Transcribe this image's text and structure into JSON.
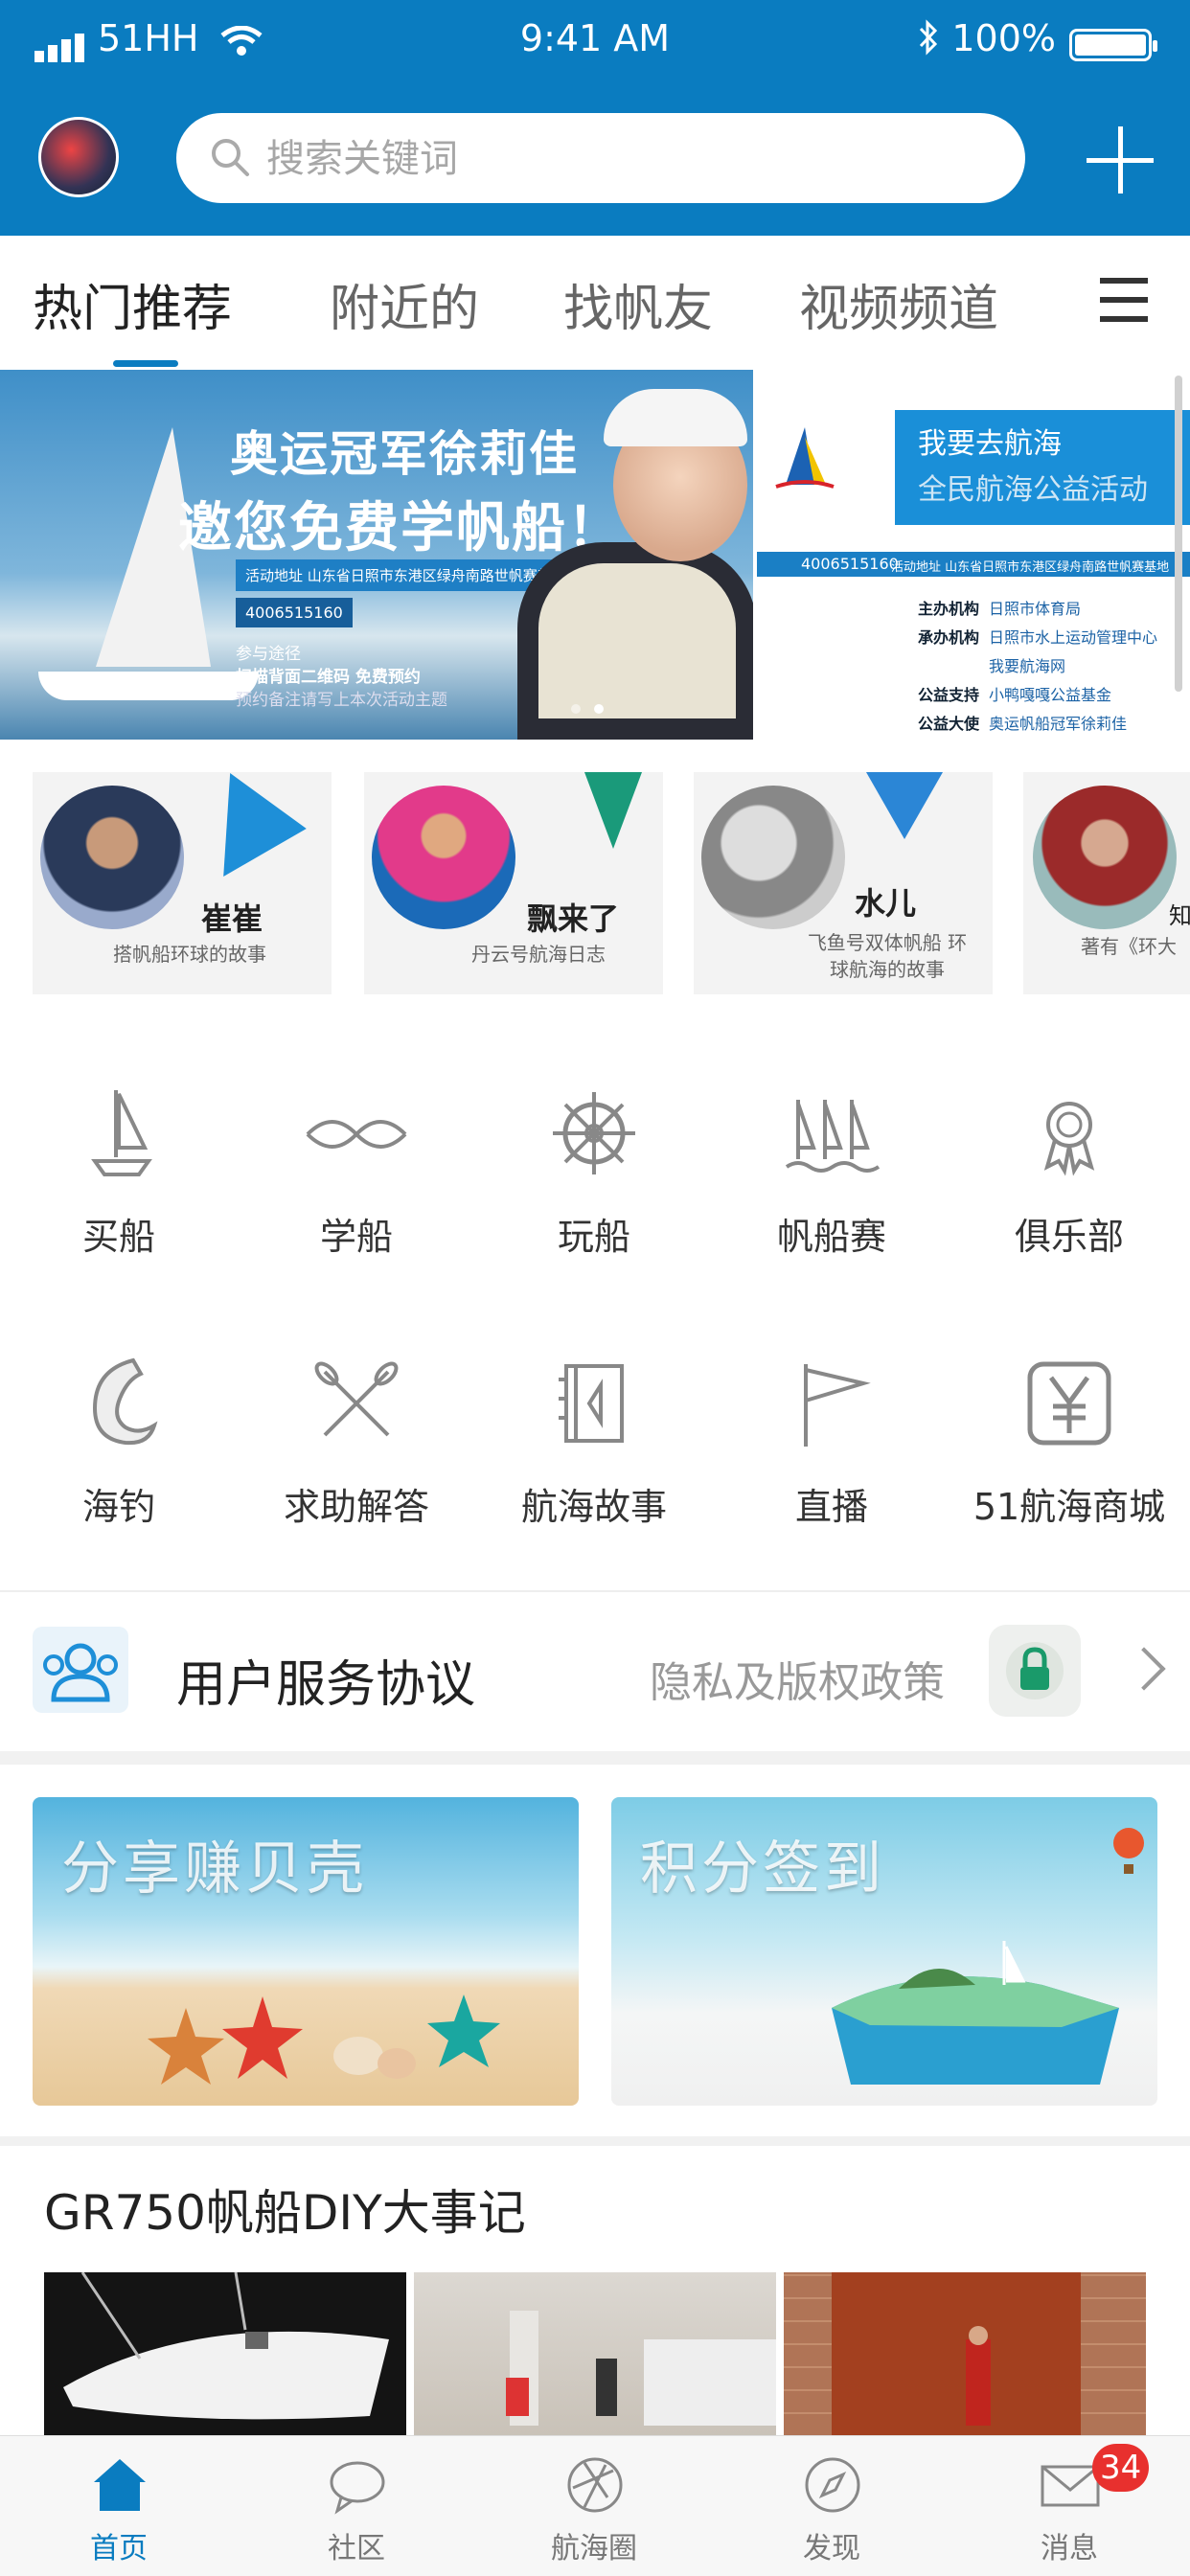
{
  "status_bar": {
    "carrier": "51HH",
    "time": "9:41 AM",
    "battery": "100%"
  },
  "search": {
    "placeholder": "搜索关键词"
  },
  "tabs": [
    {
      "label": "热门推荐",
      "active": true
    },
    {
      "label": "附近的",
      "active": false
    },
    {
      "label": "找帆友",
      "active": false
    },
    {
      "label": "视频频道",
      "active": false
    }
  ],
  "banner": {
    "title_line1": "奥运冠军徐莉佳",
    "title_line2": "邀您免费学帆船！",
    "address": "活动地址 山东省日照市东港区绿舟南路世帆赛基地",
    "phone": "4006515160",
    "step_label": "参与途径",
    "step_detail": "扫描背面二维码 免费预约",
    "note": "预约备注请写上本次活动主题",
    "right_title1": "我要去航海",
    "right_title2": "全民航海公益活动",
    "right_phone": "4006515160",
    "right_address": "活动地址 山东省日照市东港区绿舟南路世帆赛基地",
    "right_lines": [
      {
        "k": "主办机构",
        "v": "日照市体育局"
      },
      {
        "k": "承办机构",
        "v": "日照市水上运动管理中心"
      },
      {
        "k": "",
        "v": "我要航海网"
      },
      {
        "k": "公益支持",
        "v": "小鸭嘎嘎公益基金"
      },
      {
        "k": "公益大使",
        "v": "奥运帆船冠军徐莉佳"
      }
    ]
  },
  "stories": [
    {
      "name": "崔崔",
      "desc": "搭帆船环球的故事"
    },
    {
      "name": "飘来了",
      "desc": "丹云号航海日志"
    },
    {
      "name": "水儿",
      "desc": "飞鱼号双体帆船 环球航海的故事"
    },
    {
      "name": "知",
      "desc": "著有《环大"
    }
  ],
  "grid": [
    {
      "label": "买船",
      "icon": "sailboat-icon"
    },
    {
      "label": "学船",
      "icon": "knot-icon"
    },
    {
      "label": "玩船",
      "icon": "helm-wheel-icon"
    },
    {
      "label": "帆船赛",
      "icon": "regatta-icon"
    },
    {
      "label": "俱乐部",
      "icon": "badge-icon"
    },
    {
      "label": "海钓",
      "icon": "fish-icon"
    },
    {
      "label": "求助解答",
      "icon": "crossed-oars-icon"
    },
    {
      "label": "航海故事",
      "icon": "book-icon"
    },
    {
      "label": "直播",
      "icon": "flag-icon"
    },
    {
      "label": "51航海商城",
      "icon": "yen-icon"
    }
  ],
  "service": {
    "title": "用户服务协议",
    "privacy": "隐私及版权政策"
  },
  "promos": [
    {
      "title": "分享赚贝壳"
    },
    {
      "title": "积分签到"
    }
  ],
  "article": {
    "title": "GR750帆船DIY大事记"
  },
  "bottom_nav": [
    {
      "label": "首页",
      "icon": "home-icon",
      "active": true
    },
    {
      "label": "社区",
      "icon": "chat-bubble-icon",
      "active": false
    },
    {
      "label": "航海圈",
      "icon": "aperture-icon",
      "active": false
    },
    {
      "label": "发现",
      "icon": "compass-icon",
      "active": false
    },
    {
      "label": "消息",
      "icon": "mail-icon",
      "active": false,
      "badge": "34"
    }
  ],
  "colors": {
    "brand": "#0a7cc0",
    "badge": "#e8302e"
  }
}
